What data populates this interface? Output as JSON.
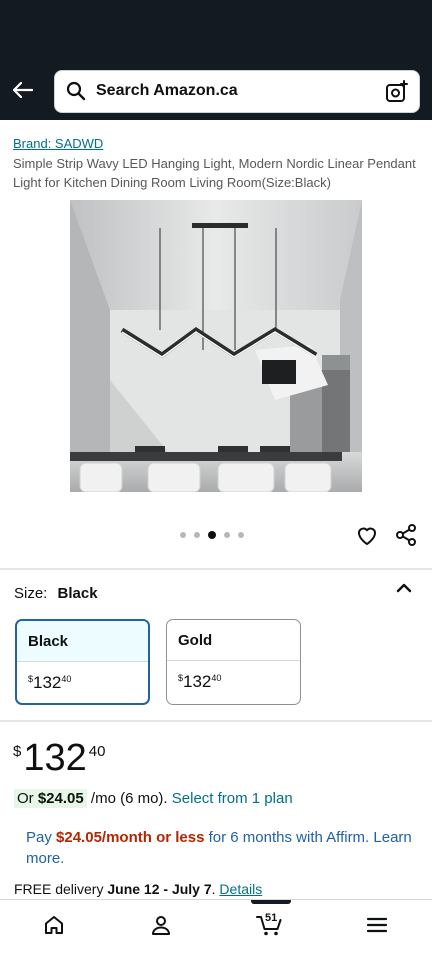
{
  "header": {
    "search_placeholder": "Search Amazon.ca",
    "back_icon": "back-arrow-icon",
    "search_icon": "search-icon",
    "lens_icon": "camera-search-icon"
  },
  "product": {
    "brand": "Brand: SADWD",
    "title": "Simple Strip Wavy LED Hanging Light, Modern Nordic Linear Pendant Light for Kitchen Dining Room Living Room(Size:Black)",
    "image_count": 5,
    "active_image": 3
  },
  "size": {
    "label": "Size:",
    "selected": "Black",
    "options": [
      {
        "name": "Black",
        "currency": "$",
        "whole": "132",
        "fraction": "40"
      },
      {
        "name": "Gold",
        "currency": "$",
        "whole": "132",
        "fraction": "40"
      }
    ]
  },
  "price": {
    "currency": "$",
    "whole": "132",
    "fraction": "40"
  },
  "installment": {
    "prefix": "Or",
    "amount": "$24.05",
    "suffix": "/mo (6 mo).",
    "link": "Select from 1 plan"
  },
  "affirm": {
    "pay": "Pay",
    "amount": "$24.05/month or less",
    "rest": "for 6 months with Affirm.",
    "learn_more": "Learn more."
  },
  "delivery": {
    "prefix": "FREE delivery",
    "dates": "June 12 - July 7",
    "period": ".",
    "link": "Details"
  },
  "nav": {
    "cart_count": "51"
  },
  "colors": {
    "header_bg": "#131a22",
    "link": "#007185",
    "selected_border": "#2162a1",
    "deal_red": "#b12704",
    "installment_bg": "#e6f7e7"
  }
}
